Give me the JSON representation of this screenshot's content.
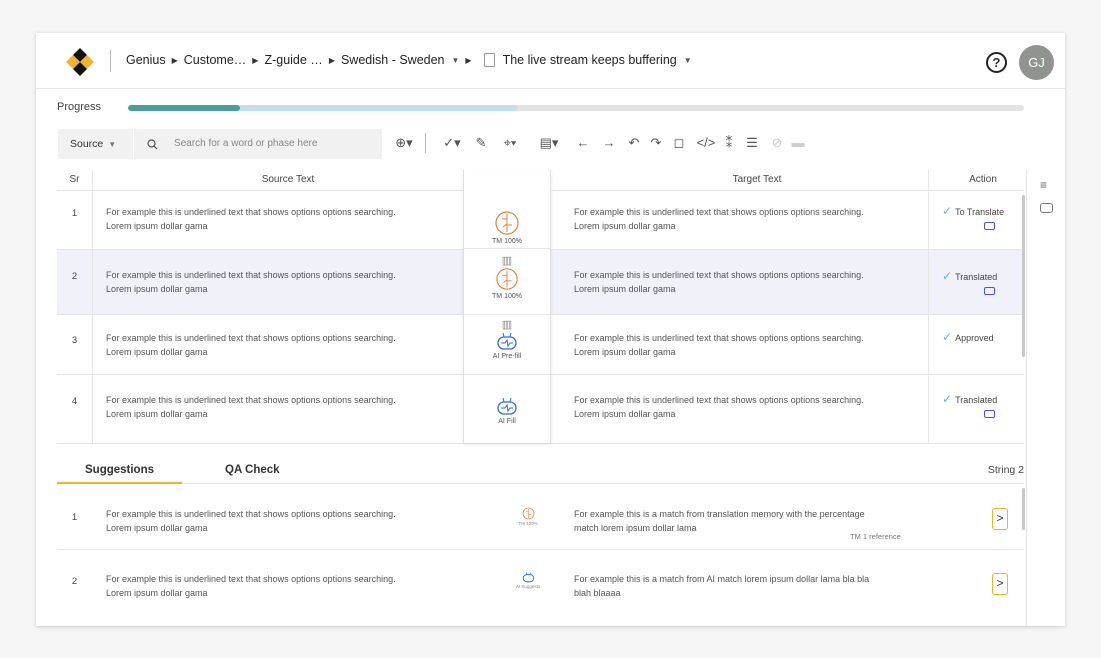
{
  "breadcrumb": {
    "items": [
      "Genius",
      "Custome…",
      "Z-guide …",
      "Swedish - Sweden"
    ],
    "document": "The live stream keeps buffering"
  },
  "user": {
    "initials": "GJ"
  },
  "progress": {
    "label": "Progress",
    "done": 0.125,
    "partial": 0.435
  },
  "toolbar": {
    "source_select": "Source",
    "search_placeholder": "Search for a word or phase here"
  },
  "table": {
    "headers": {
      "sr": "Sr",
      "source": "Source Text",
      "target": "Target Text",
      "action": "Action"
    },
    "rows": [
      {
        "sr": "1",
        "source_line1": "For example this is underlined text that shows options options searching.",
        "source_line2": "Lorem ipsum dollar gama",
        "match": "TM 100%",
        "target_line1": "For example this is underlined text that shows options options searching.",
        "target_line2": "Lorem ipsum dollar gama",
        "status": "To Translate"
      },
      {
        "sr": "2",
        "source_line1": "For example this is underlined text that shows options options searching.",
        "source_line2": "Lorem ipsum dollar gama",
        "match": "TM 100%",
        "target_line1": "For example this is underlined text that shows options options searching.",
        "target_line2": "Lorem ipsum dollar gama",
        "status": "Translated"
      },
      {
        "sr": "3",
        "source_line1": "For example this is underlined text that shows options options searching.",
        "source_line2": "Lorem ipsum dollar gama",
        "match": "AI Pre-fill",
        "target_line1": "For example this is underlined text that shows options options searching.",
        "target_line2": "Lorem ipsum dollar gama",
        "status": "Approved"
      },
      {
        "sr": "4",
        "source_line1": "For example this is underlined text that shows options options searching.",
        "source_line2": "Lorem ipsum dollar gama",
        "match": "AI Fill",
        "target_line1": "For example this is underlined text that shows options options searching.",
        "target_line2": "Lorem ipsum dollar gama",
        "status": "Translated"
      }
    ]
  },
  "panel": {
    "tabs": [
      "Suggestions",
      "QA Check"
    ],
    "string_label": "String 2",
    "suggestions": [
      {
        "sr": "1",
        "source_line1": "For example this is underlined text that shows options options searching.",
        "source_line2": "Lorem ipsum dollar gama",
        "match": "TM 100%",
        "text_line1": "For example this is a match from translation memory with the percentage",
        "text_line2": "match lorem ipsum dollar lama",
        "reference": "TM 1 reference"
      },
      {
        "sr": "2",
        "source_line1": "For example this is underlined text that shows options options searching.",
        "source_line2": "Lorem ipsum dollar gama",
        "match": "AI Suggests",
        "text_line1": "For example this is a match from AI match lorem ipsum dollar lama bla bla",
        "text_line2": "blah blaaaa"
      }
    ]
  },
  "icons": [
    "logo",
    "help-icon",
    "search-icon",
    "download-icon",
    "check-icon",
    "edit-icon",
    "tag-icon",
    "copy-icon",
    "arrow-left-icon",
    "arrow-right-icon",
    "undo-icon",
    "redo-icon",
    "preview-icon",
    "code-icon",
    "spell-icon",
    "format-icon",
    "hide-icon",
    "lock-icon",
    "filter-icon",
    "comment-icon",
    "brain-icon",
    "robot-icon"
  ],
  "colors": {
    "accent": "#f0b429",
    "progress_done": "#4b9c9c",
    "progress_partial": "#c4dcf5",
    "selected_row": "#f1f1fa",
    "brain_icon": "#e0824a",
    "robot_icon": "#2b6fd6"
  }
}
